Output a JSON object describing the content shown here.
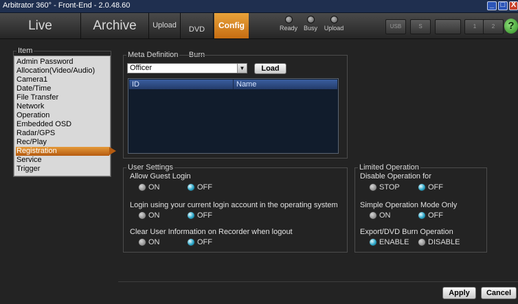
{
  "window": {
    "title": "Arbitrator 360° - Front-End - 2.0.48.60",
    "minimize_glyph": "_",
    "maximize_glyph": "□",
    "close_glyph": "X"
  },
  "toolbar": {
    "tabs": {
      "live": "Live",
      "archive": "Archive",
      "upload": "Upload",
      "dvd_line1": "DVD",
      "dvd_line2": "Burn",
      "config": "Config"
    },
    "status": {
      "ready": "Ready",
      "busy": "Busy",
      "upload": "Upload"
    },
    "icons": [
      "usb-icon",
      "usb-icon",
      "layout-icon",
      "page-1-icon",
      "page-2-icon"
    ],
    "icon_labels": {
      "usb1": "USB",
      "usb2": "S",
      "page1": "1",
      "page2": "2"
    },
    "help_label": "?",
    "accent_color": "#e08a25"
  },
  "item_panel": {
    "title": "Item",
    "items": [
      "Admin Password",
      "Allocation(Video/Audio)",
      "Camera1",
      "Date/Time",
      "File Transfer",
      "Network",
      "Operation",
      "Embedded OSD",
      "Radar/GPS",
      "Rec/Play",
      "Registration",
      "Service",
      "Trigger"
    ],
    "selected": "Registration"
  },
  "meta_definition": {
    "title": "Meta Definition",
    "dropdown_value": "Officer",
    "load_label": "Load",
    "columns": [
      "ID",
      "Name"
    ],
    "rows": []
  },
  "user_settings": {
    "title": "User Settings",
    "allow_guest_login": {
      "label": "Allow Guest Login",
      "on": "ON",
      "off": "OFF",
      "selected": "OFF"
    },
    "login_current_account": {
      "label": "Login using your current login account in the operating system",
      "on": "ON",
      "off": "OFF",
      "selected": "OFF"
    },
    "clear_user_info": {
      "label": "Clear User Information on Recorder when logout",
      "on": "ON",
      "off": "OFF",
      "selected": "OFF"
    }
  },
  "limited_operation": {
    "title": "Limited Operation",
    "disable_operation": {
      "label": "Disable Operation for",
      "stop": "STOP",
      "off": "OFF",
      "selected": "OFF"
    },
    "simple_mode": {
      "label": "Simple Operation Mode Only",
      "on": "ON",
      "off": "OFF",
      "selected": "OFF"
    },
    "export_dvd": {
      "label": "Export/DVD Burn Operation",
      "enable": "ENABLE",
      "disable": "DISABLE",
      "selected": "ENABLE"
    }
  },
  "footer": {
    "apply_label": "Apply",
    "cancel_label": "Cancel"
  }
}
